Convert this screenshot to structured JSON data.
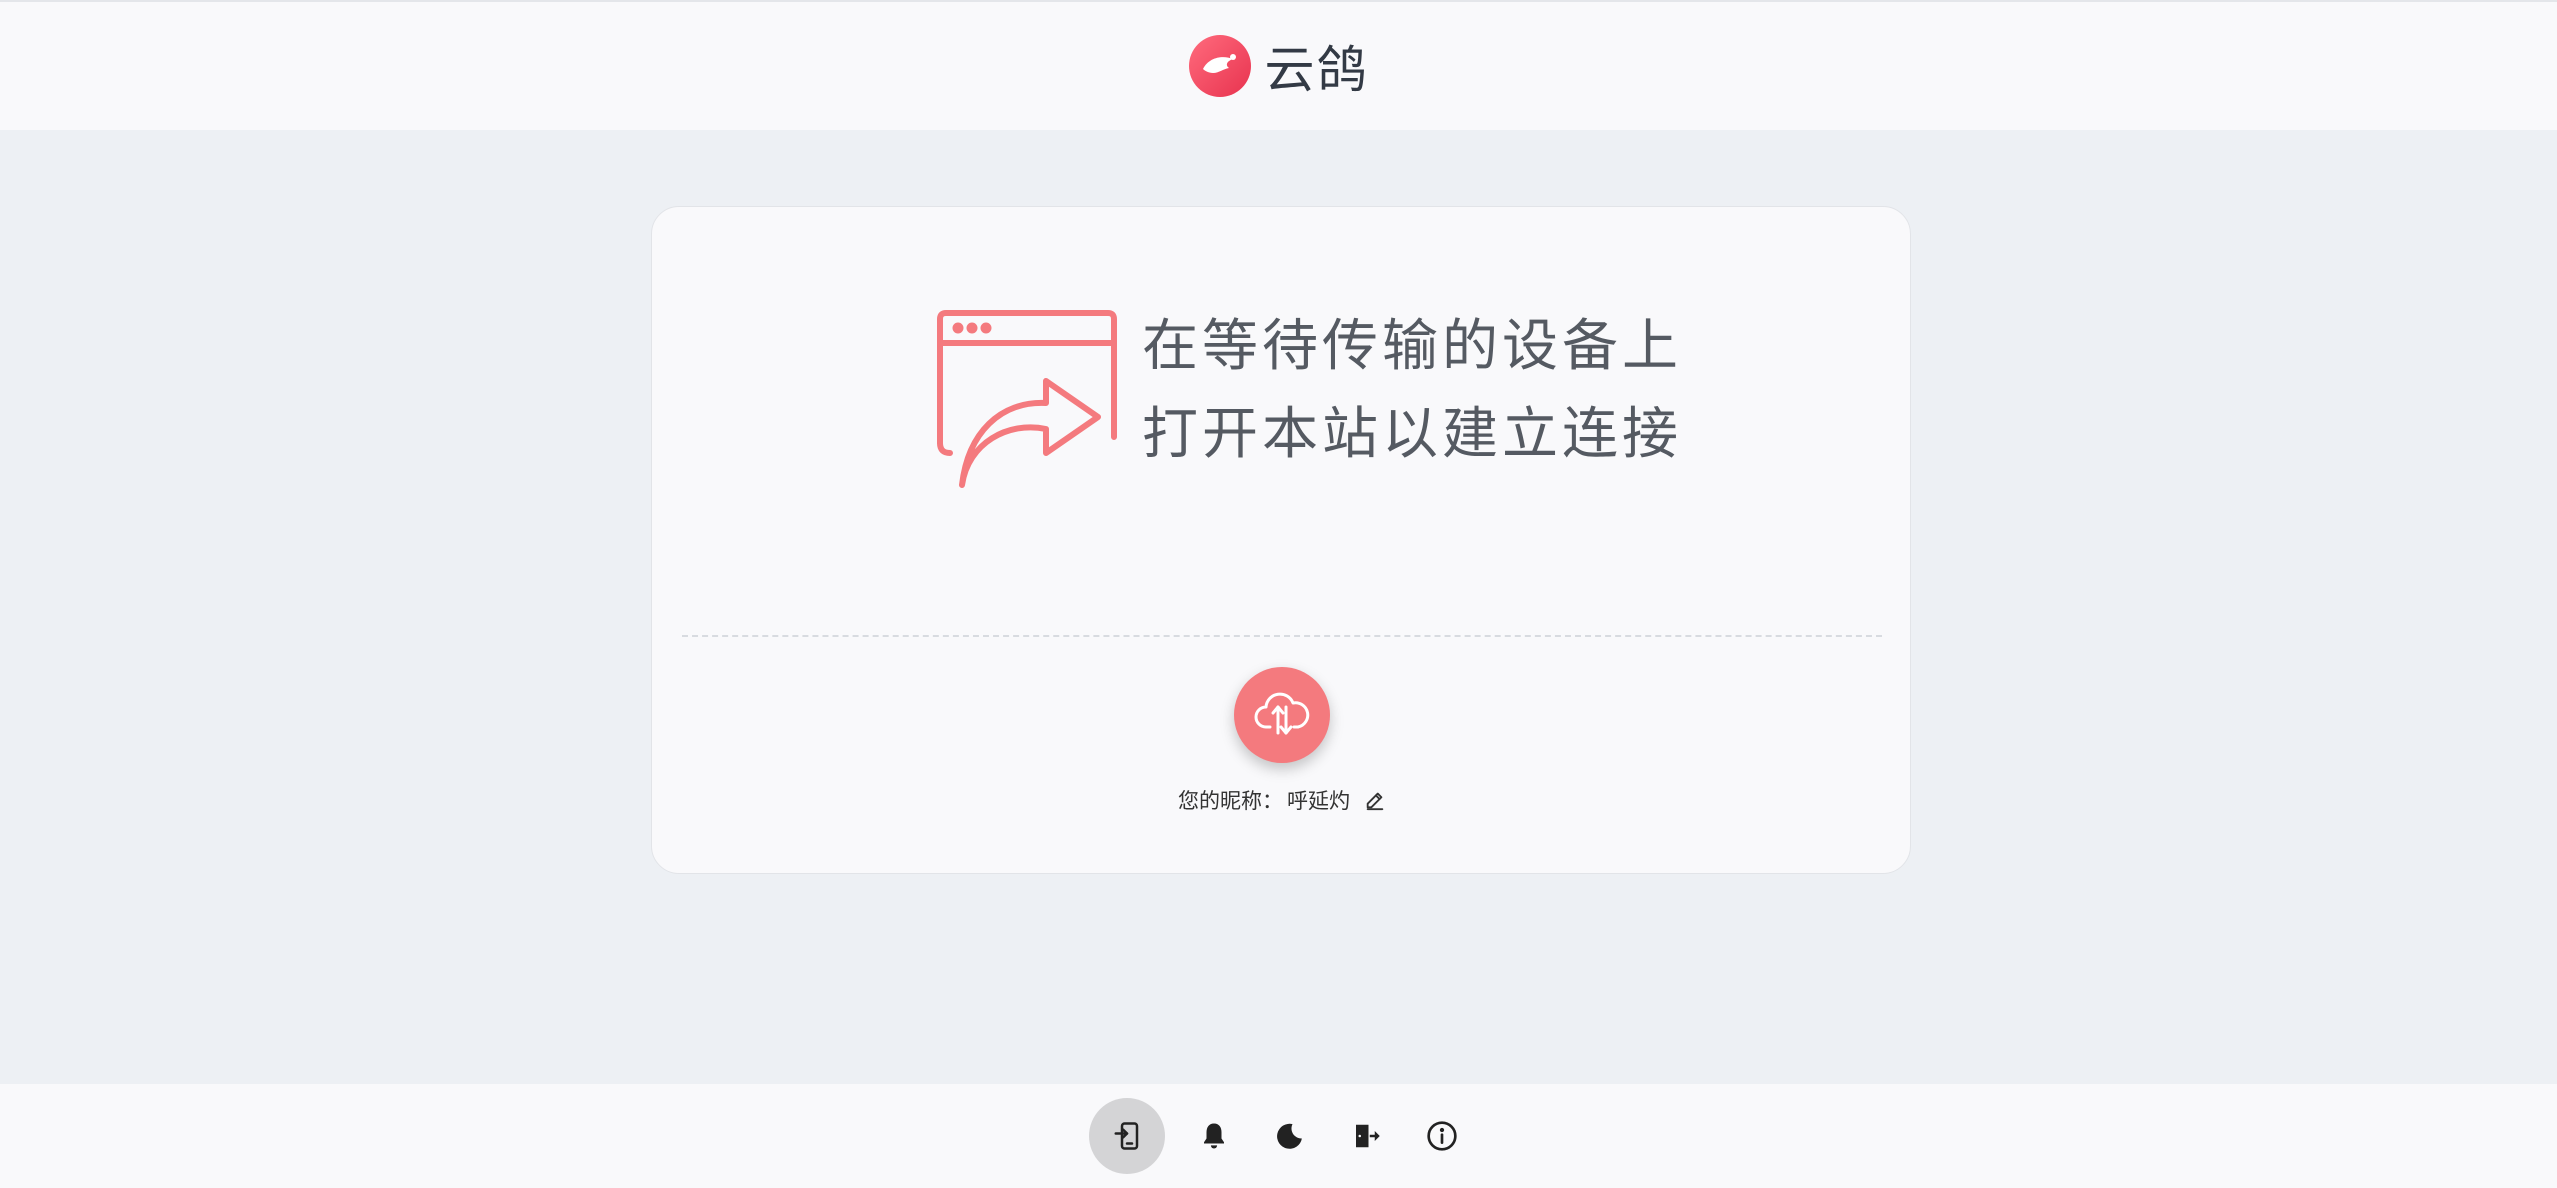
{
  "header": {
    "app_name": "云鸽",
    "logo_icon": "dove-logo-icon"
  },
  "colors": {
    "accent": "#f47a7e",
    "background": "#edf0f4",
    "surface": "#f9f9fb",
    "text": "#555a62"
  },
  "main": {
    "hint_icon": "browser-share-icon",
    "hint_line_1": "在等待传输的设备上",
    "hint_line_2": "打开本站以建立连接",
    "transfer_icon": "cloud-transfer-icon",
    "nickname_label": "您的昵称：",
    "nickname_value": "呼延灼",
    "edit_icon": "pencil-icon"
  },
  "bottom_bar": {
    "items": [
      {
        "icon": "device-connect-icon",
        "active": true
      },
      {
        "icon": "bell-icon",
        "active": false
      },
      {
        "icon": "moon-icon",
        "active": false
      },
      {
        "icon": "exit-icon",
        "active": false
      },
      {
        "icon": "info-icon",
        "active": false
      }
    ]
  }
}
